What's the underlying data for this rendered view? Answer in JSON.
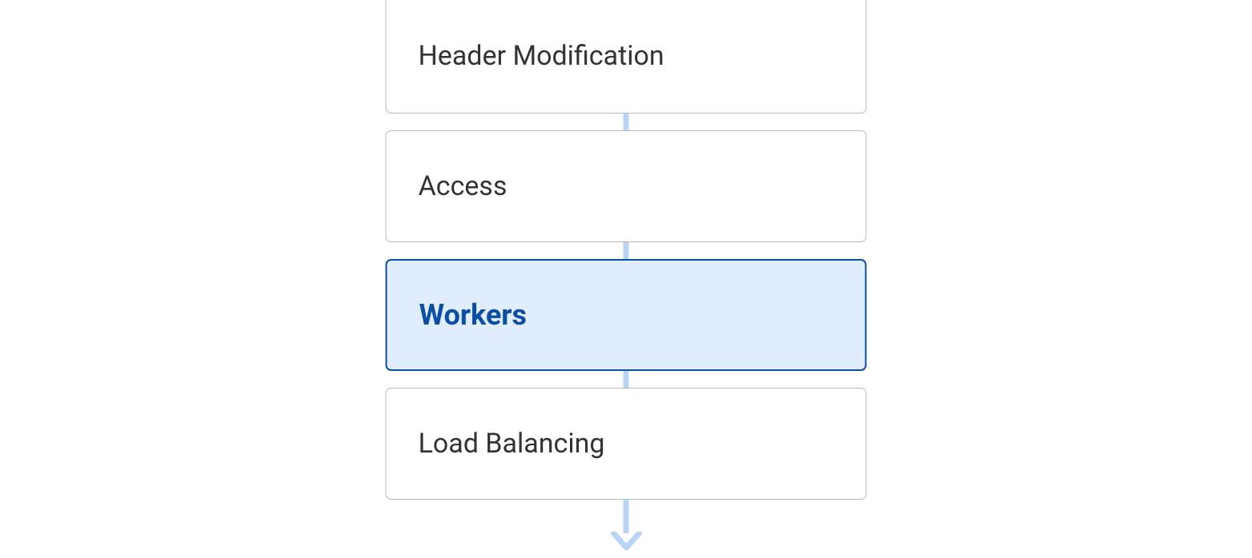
{
  "diagram": {
    "boxes": [
      {
        "label": "Header Modification",
        "highlighted": false
      },
      {
        "label": "Access",
        "highlighted": false
      },
      {
        "label": "Workers",
        "highlighted": true
      },
      {
        "label": "Load Balancing",
        "highlighted": false
      }
    ],
    "colors": {
      "box_border": "#b8b8b8",
      "highlight_border": "#0b4ea2",
      "highlight_bg": "#e0edff",
      "highlight_text": "#0b4ea2",
      "connector": "#b8d4f7",
      "text": "#333333"
    }
  }
}
